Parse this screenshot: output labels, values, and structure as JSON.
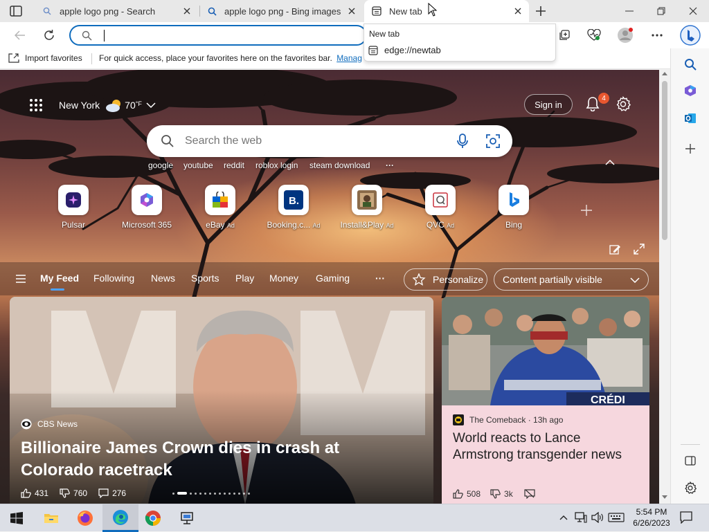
{
  "browser": {
    "tabs": [
      {
        "label": "apple logo png - Search",
        "icon": "search-icon"
      },
      {
        "label": "apple logo png - Bing images",
        "icon": "search-icon"
      },
      {
        "label": "New tab",
        "icon": "newtab-icon",
        "active": true
      }
    ],
    "address": {
      "value": "",
      "placeholder": ""
    },
    "suggestion": {
      "header": "New tab",
      "item": "edge://newtab"
    },
    "favorites_bar": {
      "import_label": "Import favorites",
      "hint": "For quick access, place your favorites here on the favorites bar.",
      "manage_link": "Manag"
    }
  },
  "newtab": {
    "location": "New York",
    "temperature": "70",
    "temp_unit": "°F",
    "sign_in": "Sign in",
    "notifications": "4",
    "search_placeholder": "Search the web",
    "quick_links": [
      "google",
      "youtube",
      "reddit",
      "roblox login",
      "steam download"
    ],
    "more": "···",
    "tiles": [
      {
        "label": "Pulsar",
        "ad": ""
      },
      {
        "label": "Microsoft 365",
        "ad": ""
      },
      {
        "label": "eBay",
        "ad": "Ad"
      },
      {
        "label": "Booking.c...",
        "ad": "Ad"
      },
      {
        "label": "Install&Play",
        "ad": "Ad"
      },
      {
        "label": "QVC",
        "ad": "Ad"
      },
      {
        "label": "Bing",
        "ad": ""
      }
    ],
    "feed_nav": {
      "items": [
        "My Feed",
        "Following",
        "News",
        "Sports",
        "Play",
        "Money",
        "Gaming"
      ],
      "more": "···",
      "personalize": "Personalize",
      "content_visibility": "Content partially visible"
    },
    "cards": {
      "main": {
        "source": "CBS News",
        "headline": "Billionaire James Crown dies in crash at Colorado racetrack",
        "likes": "431",
        "dislikes": "760",
        "comments": "276"
      },
      "side": {
        "source": "The Comeback · 13h ago",
        "headline": "World reacts to Lance Armstrong transgender news",
        "likes": "508",
        "dislikes": "3k"
      }
    }
  },
  "taskbar": {
    "time": "5:54 PM",
    "date": "6/26/2023"
  },
  "colors": {
    "accent": "#0f6cbd",
    "notification_badge": "#e8572f",
    "side_card_bg": "#f6d7de"
  }
}
